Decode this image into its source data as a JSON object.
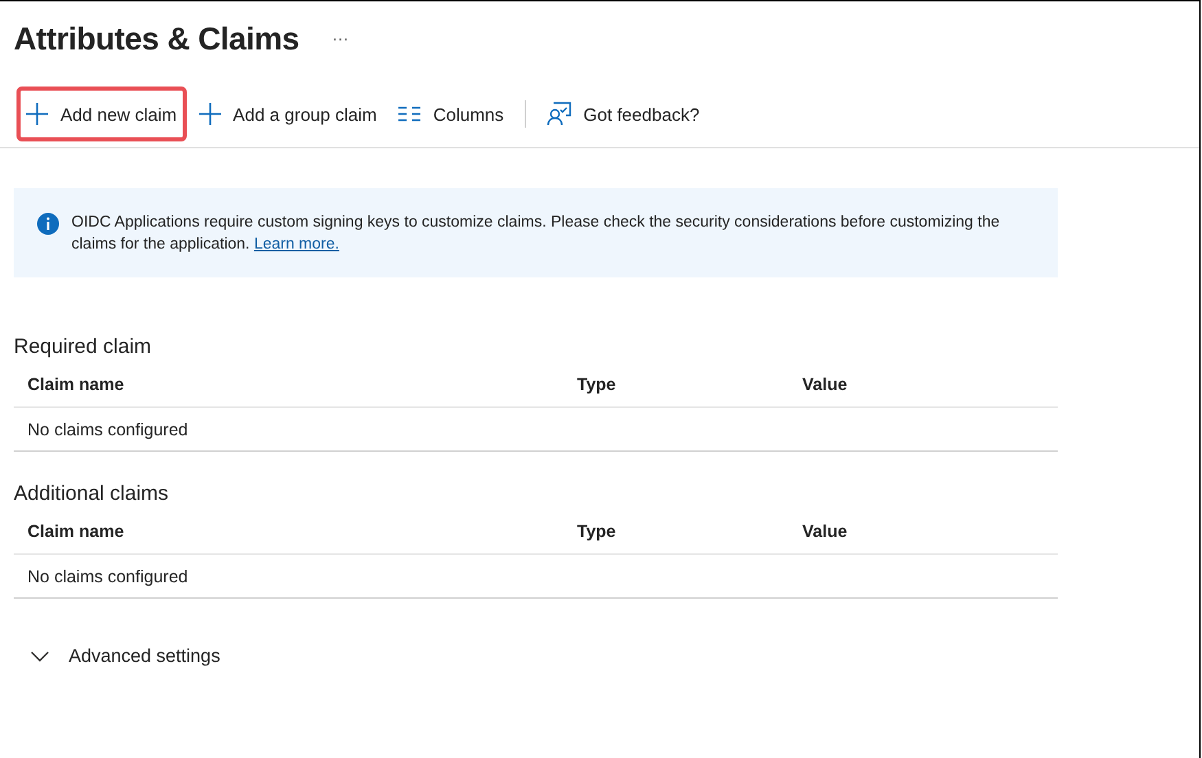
{
  "page": {
    "title": "Attributes & Claims",
    "more": "···"
  },
  "toolbar": [
    {
      "label": "Add new claim",
      "kind": "plus",
      "highlighted": true,
      "separator_before": false
    },
    {
      "label": "Add a group claim",
      "kind": "plus",
      "highlighted": false,
      "separator_before": false
    },
    {
      "label": "Columns",
      "kind": "columns",
      "highlighted": false,
      "separator_before": false
    },
    {
      "label": "Got feedback?",
      "kind": "feedback",
      "highlighted": false,
      "separator_before": true
    }
  ],
  "info_banner": {
    "text": "OIDC Applications require custom signing keys to customize claims. Please check the security considerations before customizing the claims for the application.",
    "link": "Learn more."
  },
  "sections": [
    {
      "heading": "Required claim",
      "columns": [
        "Claim name",
        "Type",
        "Value"
      ],
      "empty_text": "No claims configured"
    },
    {
      "heading": "Additional claims",
      "columns": [
        "Claim name",
        "Type",
        "Value"
      ],
      "empty_text": "No claims configured"
    }
  ],
  "advanced": {
    "label": "Advanced settings",
    "expanded": false
  }
}
